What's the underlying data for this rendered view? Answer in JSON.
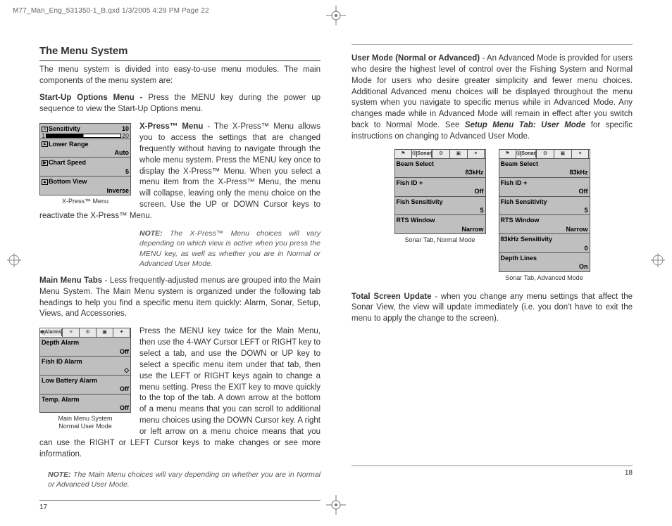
{
  "print_header": "M77_Man_Eng_531350-1_B.qxd  1/3/2005  4:29 PM  Page 22",
  "left": {
    "title": "The Menu System",
    "intro": "The menu system is divided into easy-to-use menu modules. The main components of the menu system are:",
    "startup_label": "Start-Up Options Menu -",
    "startup_text": " Press the MENU key during the power up sequence to view the Start-Up Options menu.",
    "xpress_label": "X-Press™ Menu",
    "xpress_text": " - The X-Press™ Menu allows you to access the settings that are changed frequently without having to navigate through the whole menu system. Press the MENU key once to display the X-Press™ Menu. When you select a menu item from the X-Press™ Menu, the menu will collapse, leaving only the menu choice on the screen. Use the UP or DOWN Cursor keys to reactivate the X-Press™ Menu.",
    "xpress_caption": "X-Press™ Menu",
    "xpress_note_lead": "NOTE:",
    "xpress_note": " The X-Press™ Menu choices will vary depending on which view is active when you press the MENU key, as well as whether you are in Normal or Advanced User Mode.",
    "main_tabs_label": "Main Menu Tabs",
    "main_tabs_text": " - Less frequently-adjusted menus are grouped into the Main Menu System. The Main Menu system is organized under the following tab headings to help you find a specific menu item quickly: Alarm, Sonar, Setup, Views, and Accessories.",
    "main_caption1": "Main Menu System",
    "main_caption2": "Normal User Mode",
    "main_press_text": "Press the MENU key twice for the Main Menu, then use the 4-WAY Cursor LEFT or RIGHT key to select a tab, and use the DOWN or UP key to select a specific menu item under that tab, then use the LEFT or RIGHT keys again to change a menu setting. Press the EXIT key to move quickly to the top of the tab. A down arrow at the bottom of a menu means that you can scroll to additional menu choices using the DOWN Cursor key. A right or left arrow on a menu choice means that you can use the RIGHT or LEFT Cursor keys to make changes or see more information.",
    "main_note_lead": "NOTE:",
    "main_note": " The Main Menu choices will vary depending on whether you are in Normal or Advanced User Mode.",
    "footer": "17",
    "shot_xpress": [
      {
        "label": "Sensitivity",
        "right": "10",
        "bar_lo": "1",
        "bar_hi": "20"
      },
      {
        "label": "Lower Range",
        "val": "Auto"
      },
      {
        "label": "Chart Speed",
        "val": "5"
      },
      {
        "label": "Bottom View",
        "val": "Inverse"
      }
    ],
    "shot_alarms_tab": "Alarms",
    "shot_alarms": [
      {
        "label": "Depth Alarm",
        "val": "Off"
      },
      {
        "label": "Fish ID Alarm",
        "val": "◇"
      },
      {
        "label": "Low Battery Alarm",
        "val": "Off"
      },
      {
        "label": "Temp. Alarm",
        "val": "Off"
      }
    ]
  },
  "right": {
    "usermode_label": "User Mode (Normal or Advanced)",
    "usermode_text": " - An Advanced Mode is provided for users who desire the highest level of control over the Fishing System and Normal Mode for users who desire greater simplicity and fewer menu choices. Additional Advanced menu choices will be displayed throughout the menu system when you navigate to specific menus while in Advanced Mode. Any changes made while in Advanced Mode will remain in effect after you switch back to Normal Mode. See ",
    "usermode_ref": "Setup Menu Tab: User Mode",
    "usermode_tail": " for specific instructions on changing to Advanced User Mode.",
    "caption_normal": "Sonar Tab, Normal Mode",
    "caption_advanced": "Sonar Tab, Advanced Mode",
    "sonar_tab_label": "Sonar",
    "shot_normal": [
      {
        "label": "Beam Select",
        "val": "83kHz"
      },
      {
        "label": "Fish ID +",
        "val": "Off"
      },
      {
        "label": "Fish Sensitivity",
        "val": "5"
      },
      {
        "label": "RTS Window",
        "val": "Narrow"
      }
    ],
    "shot_advanced": [
      {
        "label": "Beam Select",
        "val": "83kHz"
      },
      {
        "label": "Fish ID +",
        "val": "Off"
      },
      {
        "label": "Fish Sensitivity",
        "val": "5"
      },
      {
        "label": "RTS Window",
        "val": "Narrow"
      },
      {
        "label": "83kHz Sensitivity",
        "val": "0"
      },
      {
        "label": "Depth Lines",
        "val": "On"
      }
    ],
    "total_label": "Total Screen Update",
    "total_text": " - when you change any menu settings that affect the Sonar View, the view will update immediately (i.e. you don't have to exit the menu to apply the change to the screen).",
    "footer": "18"
  }
}
